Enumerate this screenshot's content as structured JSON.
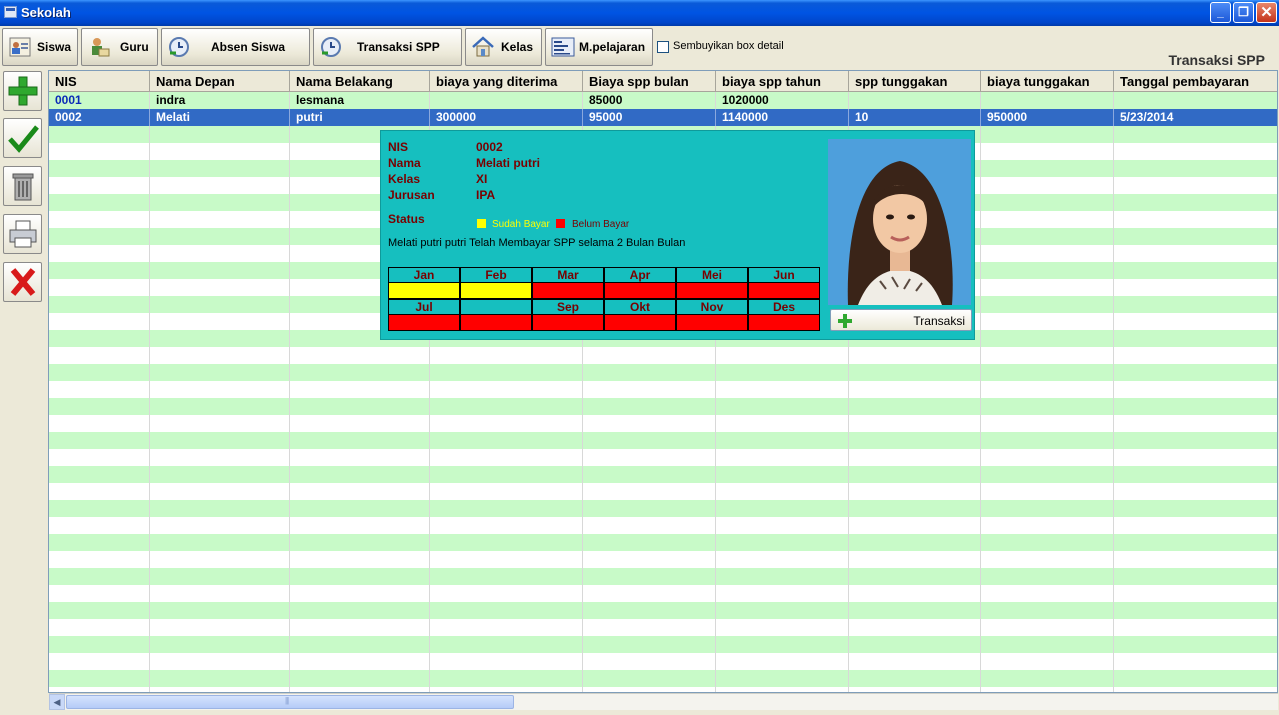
{
  "window": {
    "title": "Sekolah"
  },
  "toolbar": {
    "buttons": [
      {
        "label": "Siswa",
        "icon": "student-card-icon"
      },
      {
        "label": "Guru",
        "icon": "teacher-icon"
      },
      {
        "label": "Absen Siswa",
        "icon": "attendance-icon"
      },
      {
        "label": "Transaksi  SPP",
        "icon": "payment-icon"
      },
      {
        "label": "Kelas",
        "icon": "house-icon"
      },
      {
        "label": "M.pelajaran",
        "icon": "subject-list-icon"
      }
    ],
    "hide_detail_label": "Sembuyikan box detail",
    "hide_detail_checked": false,
    "page_label": "Transaksi SPP"
  },
  "side_buttons": [
    {
      "icon": "add-plus-icon"
    },
    {
      "icon": "check-icon"
    },
    {
      "icon": "trash-icon"
    },
    {
      "icon": "printer-icon"
    },
    {
      "icon": "close-x-icon"
    }
  ],
  "grid": {
    "columns": [
      "NIS",
      "Nama Depan",
      "Nama Belakang",
      "biaya yang diterima",
      "Biaya spp bulan",
      "biaya spp tahun",
      "spp tunggakan",
      "biaya tunggakan",
      "Tanggal pembayaran"
    ],
    "rows": [
      [
        "0001",
        "indra",
        "lesmana",
        "",
        "85000",
        "1020000",
        "",
        "",
        ""
      ],
      [
        "0002",
        "Melati",
        "putri",
        "300000",
        "95000",
        "1140000",
        "10",
        "950000",
        "5/23/2014"
      ]
    ],
    "selected_row": 1
  },
  "detail": {
    "labels": {
      "nis": "NIS",
      "nama": "Nama",
      "kelas": "Kelas",
      "jurusan": "Jurusan",
      "status": "Status"
    },
    "values": {
      "nis": "0002",
      "nama": "Melati  putri",
      "kelas": "XI",
      "jurusan": "IPA"
    },
    "legend": {
      "paid": "Sudah Bayar",
      "unpaid": "Belum Bayar"
    },
    "colors": {
      "paid": "#ffff00",
      "unpaid": "#ff0000",
      "panel": "#16bfbf"
    },
    "summary": "Melati  putri putri Telah Membayar SPP selama 2 Bulan Bulan",
    "months": [
      {
        "name": "Jan",
        "paid": true
      },
      {
        "name": "Feb",
        "paid": true
      },
      {
        "name": "Mar",
        "paid": false
      },
      {
        "name": "Apr",
        "paid": false
      },
      {
        "name": "Mei",
        "paid": false
      },
      {
        "name": "Jun",
        "paid": false
      },
      {
        "name": "Jul",
        "paid": false
      },
      {
        "name": "",
        "paid": false
      },
      {
        "name": "Sep",
        "paid": false
      },
      {
        "name": "Okt",
        "paid": false
      },
      {
        "name": "Nov",
        "paid": false
      },
      {
        "name": "Des",
        "paid": false
      }
    ],
    "transaksi_label": "Transaksi"
  }
}
